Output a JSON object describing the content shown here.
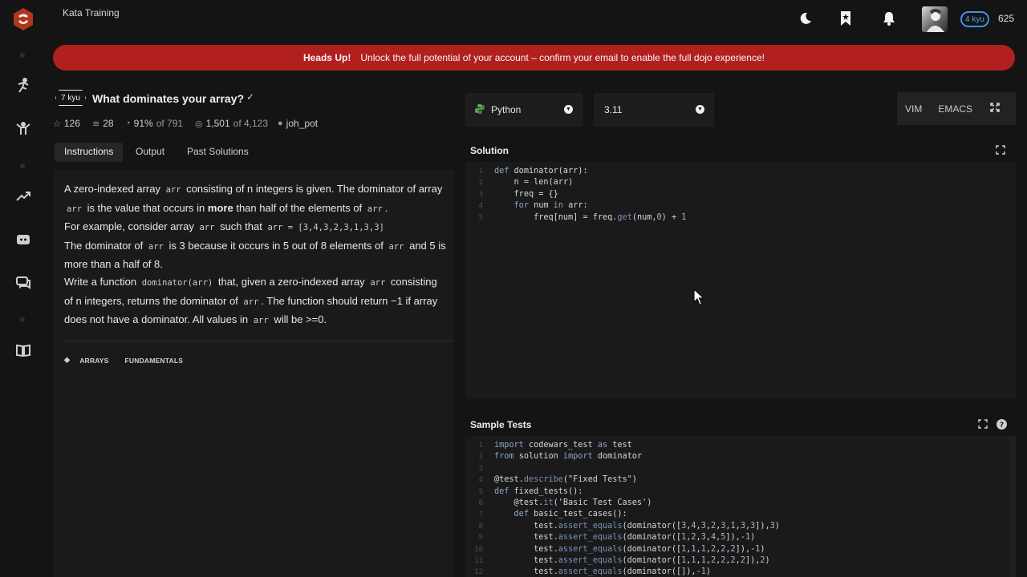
{
  "topbar": {
    "title": "Kata Training",
    "rank": "4 kyu",
    "honor": "625"
  },
  "banner": {
    "heading": "Heads Up!",
    "message": "Unlock the full potential of your account – confirm your email to enable the full dojo experience!"
  },
  "kata": {
    "rank": "7 kyu",
    "title": "What dominates your array?",
    "stats": {
      "stars": "126",
      "collections": "28",
      "satisfaction": "91%",
      "satisfaction_of": "of 791",
      "completed": "1,501",
      "completed_of": "of 4,123",
      "author": "joh_pot"
    }
  },
  "tabs": [
    "Instructions",
    "Output",
    "Past Solutions"
  ],
  "instructions": {
    "arr": "arr",
    "p1a": "A zero-indexed array",
    "p1b": "consisting of n integers is given. The dominator of array",
    "p1c": "is the value that occurs in",
    "more": "more",
    "p1d": "than half of the elements of",
    "p1e": ".",
    "p2a": "For example, consider array",
    "p2b": "such that",
    "p2code": "arr = [3,4,3,2,3,1,3,3]",
    "p3a": "The dominator of",
    "p3b": "is 3 because it occurs in 5 out of 8 elements of",
    "p3c": "and 5 is more than a half of 8.",
    "p4a": "Write a function",
    "p4code": "dominator(arr)",
    "p4b": "that, given a zero-indexed array",
    "p4c": "consisting of n integers, returns the dominator of",
    "p4d": ". The function should return −1 if array does not have a dominator. All values in",
    "p4e": "will be >=0."
  },
  "tags": [
    "ARRAYS",
    "FUNDAMENTALS"
  ],
  "editor": {
    "language": "Python",
    "version": "3.11",
    "modes": [
      "VIM",
      "EMACS"
    ],
    "solution_title": "Solution",
    "tests_title": "Sample Tests"
  },
  "solution_code": [
    {
      "n": "1",
      "t": "def dominator(arr):"
    },
    {
      "n": "2",
      "t": "    n = len(arr)"
    },
    {
      "n": "3",
      "t": "    freq = {}"
    },
    {
      "n": "4",
      "t": "    for num in arr:"
    },
    {
      "n": "5",
      "t": "        freq[num] = freq.get(num,0) + 1"
    }
  ],
  "test_code": [
    {
      "n": "1",
      "t": "import codewars_test as test"
    },
    {
      "n": "2",
      "t": "from solution import dominator"
    },
    {
      "n": "3",
      "t": ""
    },
    {
      "n": "4",
      "t": "@test.describe(\"Fixed Tests\")"
    },
    {
      "n": "5",
      "t": "def fixed_tests():"
    },
    {
      "n": "6",
      "t": "    @test.it('Basic Test Cases')"
    },
    {
      "n": "7",
      "t": "    def basic_test_cases():"
    },
    {
      "n": "8",
      "t": "        test.assert_equals(dominator([3,4,3,2,3,1,3,3]),3)"
    },
    {
      "n": "9",
      "t": "        test.assert_equals(dominator([1,2,3,4,5]),-1)"
    },
    {
      "n": "10",
      "t": "        test.assert_equals(dominator([1,1,1,2,2,2]),-1)"
    },
    {
      "n": "11",
      "t": "        test.assert_equals(dominator([1,1,1,2,2,2,2]),2)"
    },
    {
      "n": "12",
      "t": "        test.assert_equals(dominator([]),-1)"
    }
  ],
  "colors": {
    "banner": "#b1201f",
    "brand": "#b1361e",
    "rank_blue": "#3f8fe8"
  }
}
